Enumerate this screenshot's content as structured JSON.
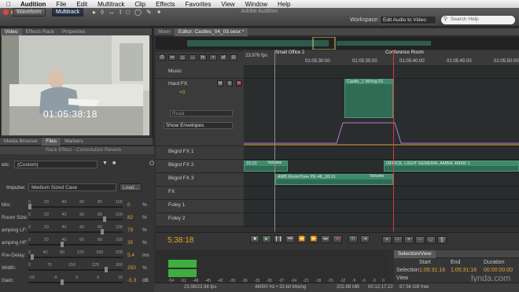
{
  "menubar": {
    "apple": "",
    "app": "Audition",
    "items": [
      "File",
      "Edit",
      "Multitrack",
      "Clip",
      "Effects",
      "Favorites",
      "View",
      "Window",
      "Help"
    ]
  },
  "toolbar": {
    "waveform": "Waveform",
    "multitrack": "Multitrack",
    "window_title": "Adobe Audition",
    "workspace_label": "Workspace:",
    "workspace_value": "Edit Audio to Video",
    "search_placeholder": "Search Help"
  },
  "video_panel": {
    "tabs": [
      "Video",
      "Effects Rack",
      "Properties"
    ],
    "timecode": "01:05:38:18"
  },
  "lower_tabs": [
    "Media Browser",
    "Files",
    "Markers"
  ],
  "rack": {
    "title": "Rack Effect - Convolution Reverb",
    "preset_label": "ets:",
    "preset_value": "(Custom)",
    "impulse_label": "Impulse:",
    "impulse_value": "Medium Sized Cave",
    "load_button": "Load...",
    "params": [
      {
        "label": "Mix:",
        "ticks": [
          "0",
          "20",
          "40",
          "60",
          "80",
          "100"
        ],
        "value": "0",
        "unit": "%"
      },
      {
        "label": "Room Size:",
        "ticks": [
          "0",
          "20",
          "40",
          "60",
          "80",
          "100"
        ],
        "value": "82",
        "unit": "%"
      },
      {
        "label": "amping LF:",
        "ticks": [
          "0",
          "20",
          "40",
          "60",
          "80",
          "100"
        ],
        "value": "79",
        "unit": "%"
      },
      {
        "label": "amping HF:",
        "ticks": [
          "0",
          "20",
          "40",
          "60",
          "80",
          "100"
        ],
        "value": "35",
        "unit": "%"
      },
      {
        "label": "Pre-Delay:",
        "ticks": [
          "0",
          "40",
          "80",
          "120",
          "160",
          "200"
        ],
        "value": "5.4",
        "unit": "ms"
      },
      {
        "label": "Width:",
        "ticks": [
          "0",
          "75",
          "150",
          "225",
          "300"
        ],
        "value": "250",
        "unit": "%"
      },
      {
        "label": "Gain:",
        "ticks": [
          "-18",
          "-9",
          "0",
          "9",
          "18"
        ],
        "value": "-5.3",
        "unit": "dB"
      }
    ]
  },
  "editor": {
    "tabs": [
      "Mixer",
      "Editor: Castles_04_03.sesx *"
    ],
    "fps": "23.976 fps",
    "markers": [
      "Small Office 2",
      "Conference Room"
    ],
    "ruler": [
      "01:05:30:00",
      "01:05:35:00",
      "01:05:40:00",
      "01:05:45:00",
      "01:05:50:00"
    ],
    "tracks": [
      {
        "name": "Music"
      },
      {
        "name": "Hard FX"
      },
      {
        "name": "Bkgrd FX 1"
      },
      {
        "name": "Bkgrd FX 2"
      },
      {
        "name": "Bkgrd FX 3"
      },
      {
        "name": "FX"
      },
      {
        "name": "Foley 1"
      },
      {
        "name": "Foley 2"
      }
    ],
    "read_label": "Read",
    "show_envelopes": "Show Envelopes",
    "volume_value": "+0",
    "clips": {
      "hardfx": "Castle_1 Wiring 01",
      "bk2a": "15.01",
      "bk2a_vol": "Volume",
      "bk2b": "OFFICE, LIGHT GENERAL AMBIE 48000 1",
      "bk3": "AMB RoomTone PE-48_28.01",
      "bk3_vol": "Volume"
    },
    "big_timecode": "5:38:18"
  },
  "meters": {
    "scale": [
      "-54",
      "-51",
      "-48",
      "-45",
      "-42",
      "-39",
      "-36",
      "-33",
      "-30",
      "-27",
      "-24",
      "-21",
      "-18",
      "-15",
      "-12",
      "-9",
      "-6",
      "-3",
      "0"
    ]
  },
  "selection": {
    "tabs": [
      "Selection/View"
    ],
    "headers": [
      "Start",
      "End",
      "Duration"
    ],
    "rows": [
      {
        "label": "Selection",
        "start": "1:05:31:16",
        "end": "1:05:31:16",
        "duration": "00:00:00:00"
      },
      {
        "label": "View",
        "start": "",
        "end": "",
        "duration": ""
      }
    ]
  },
  "status": {
    "rate": "23.98/23.98 fps",
    "format": "48000 Hz • 32-bit Mixing",
    "size": "202.88 MB",
    "duration": "00:12:17:22",
    "free": "87.56 GB free"
  },
  "watermark": "lynda.com"
}
